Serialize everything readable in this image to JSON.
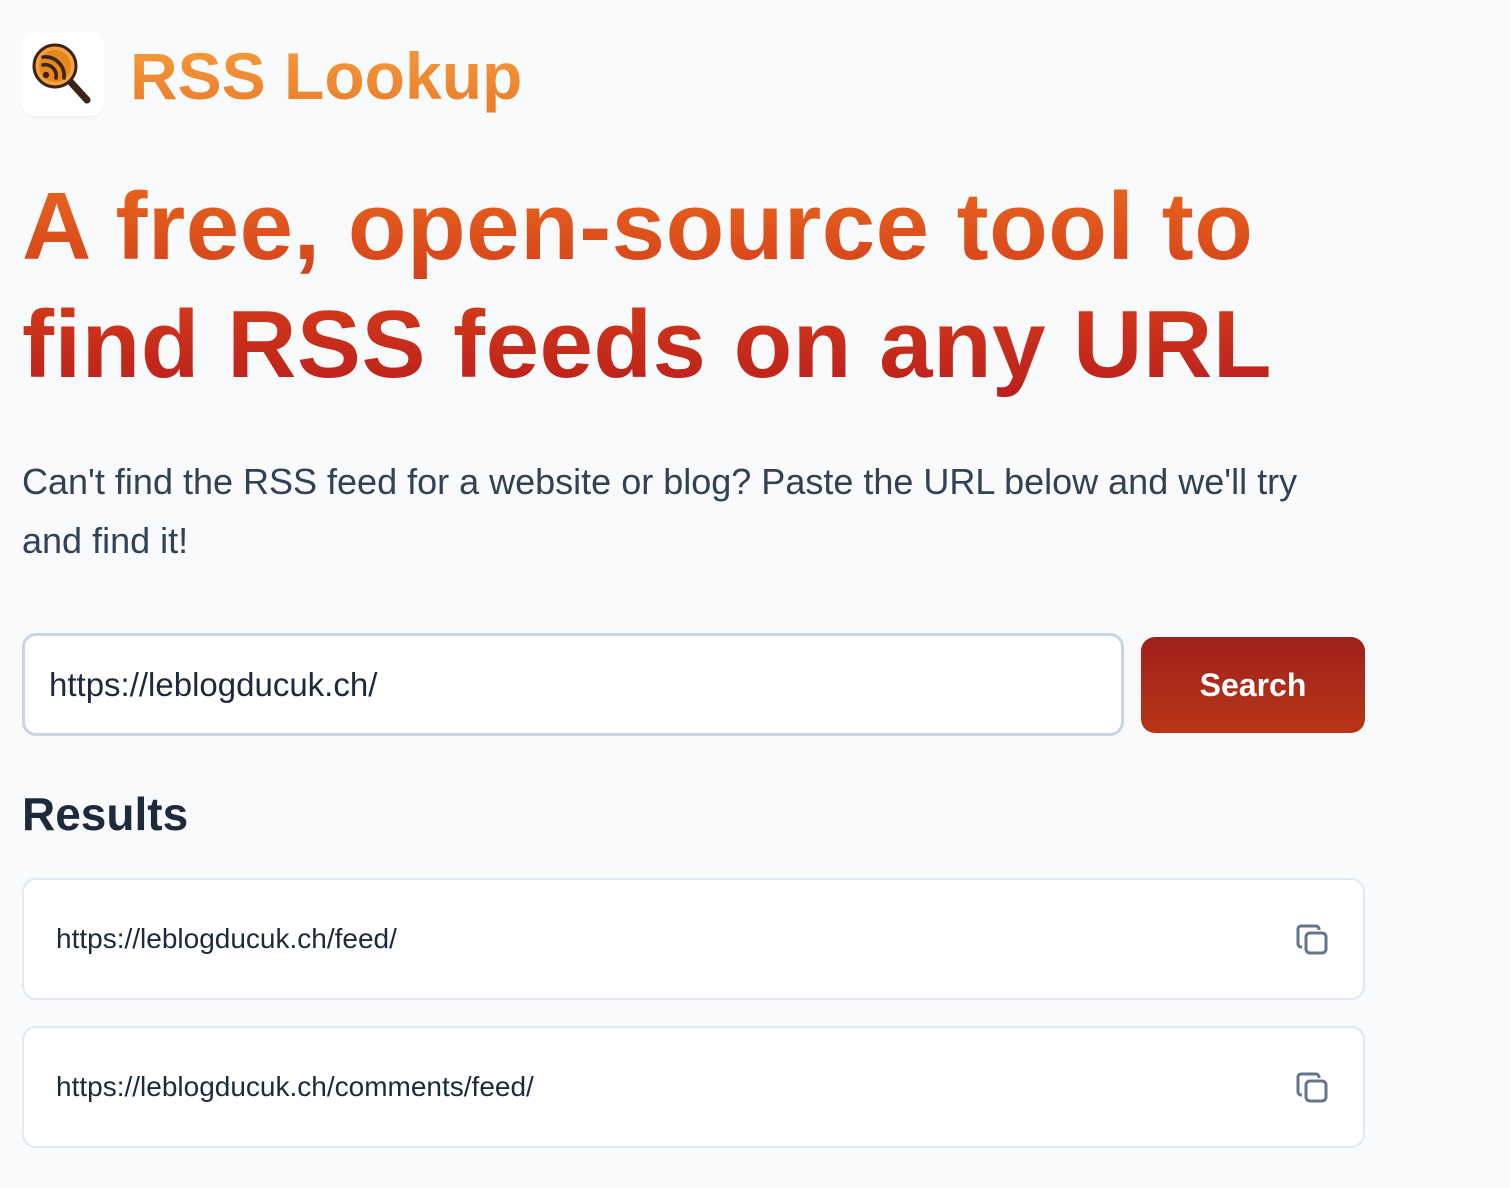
{
  "header": {
    "logo_icon": "rss-magnifier-icon",
    "title": "RSS Lookup"
  },
  "hero": {
    "headline": "A free, open-source tool to find RSS feeds on any URL",
    "subtitle": "Can't find the RSS feed for a website or blog? Paste the URL below and we'll try and find it!"
  },
  "search": {
    "value": "https://leblogducuk.ch/",
    "button_label": "Search"
  },
  "results": {
    "heading": "Results",
    "items": [
      {
        "url": "https://leblogducuk.ch/feed/",
        "action_icon": "copy-icon"
      },
      {
        "url": "https://leblogducuk.ch/comments/feed/",
        "action_icon": "copy-icon"
      }
    ]
  },
  "colors": {
    "brand_orange": "#f18a33",
    "headline_top": "#ea6a1e",
    "headline_bottom": "#b91c1c",
    "button_top": "#a0201c",
    "button_bottom": "#b83616",
    "page_background": "#f8fafc",
    "body_text": "#334155",
    "heading_text": "#1e293b"
  }
}
